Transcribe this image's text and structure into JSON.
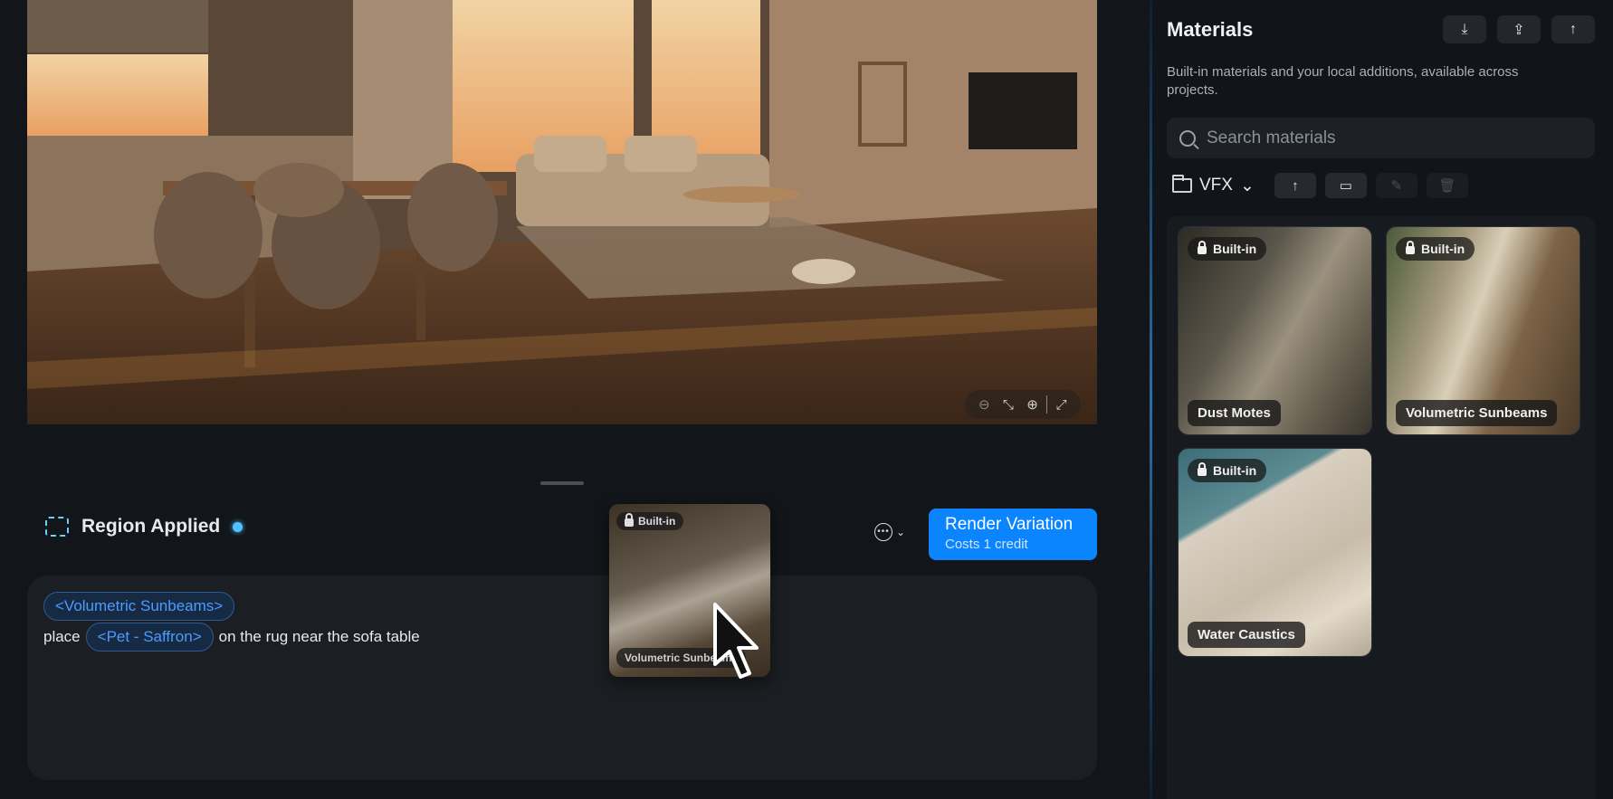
{
  "workspace": {
    "region_title": "Region Applied",
    "render_button": {
      "label": "Render Variation",
      "sublabel": "Costs 1 credit"
    },
    "prompt": {
      "chip_1": "<Volumetric Sunbeams>",
      "prefix": "place",
      "chip_2": "<Pet - Saffron>",
      "suffix": "on the rug near the sofa table"
    },
    "drag_ghost": {
      "badge": "Built-in",
      "label": "Volumetric Sunbeams"
    }
  },
  "materials_panel": {
    "title": "Materials",
    "description": "Built-in materials and your local additions, available across projects.",
    "search_placeholder": "Search materials",
    "folder": "VFX",
    "items": [
      {
        "badge": "Built-in",
        "label": "Dust Motes"
      },
      {
        "badge": "Built-in",
        "label": "Volumetric Sunbeams"
      },
      {
        "badge": "Built-in",
        "label": "Water Caustics"
      }
    ]
  },
  "colors": {
    "accent": "#0a84ff",
    "chip_text": "#4c9bff",
    "region_outline": "#6ad0ff"
  }
}
